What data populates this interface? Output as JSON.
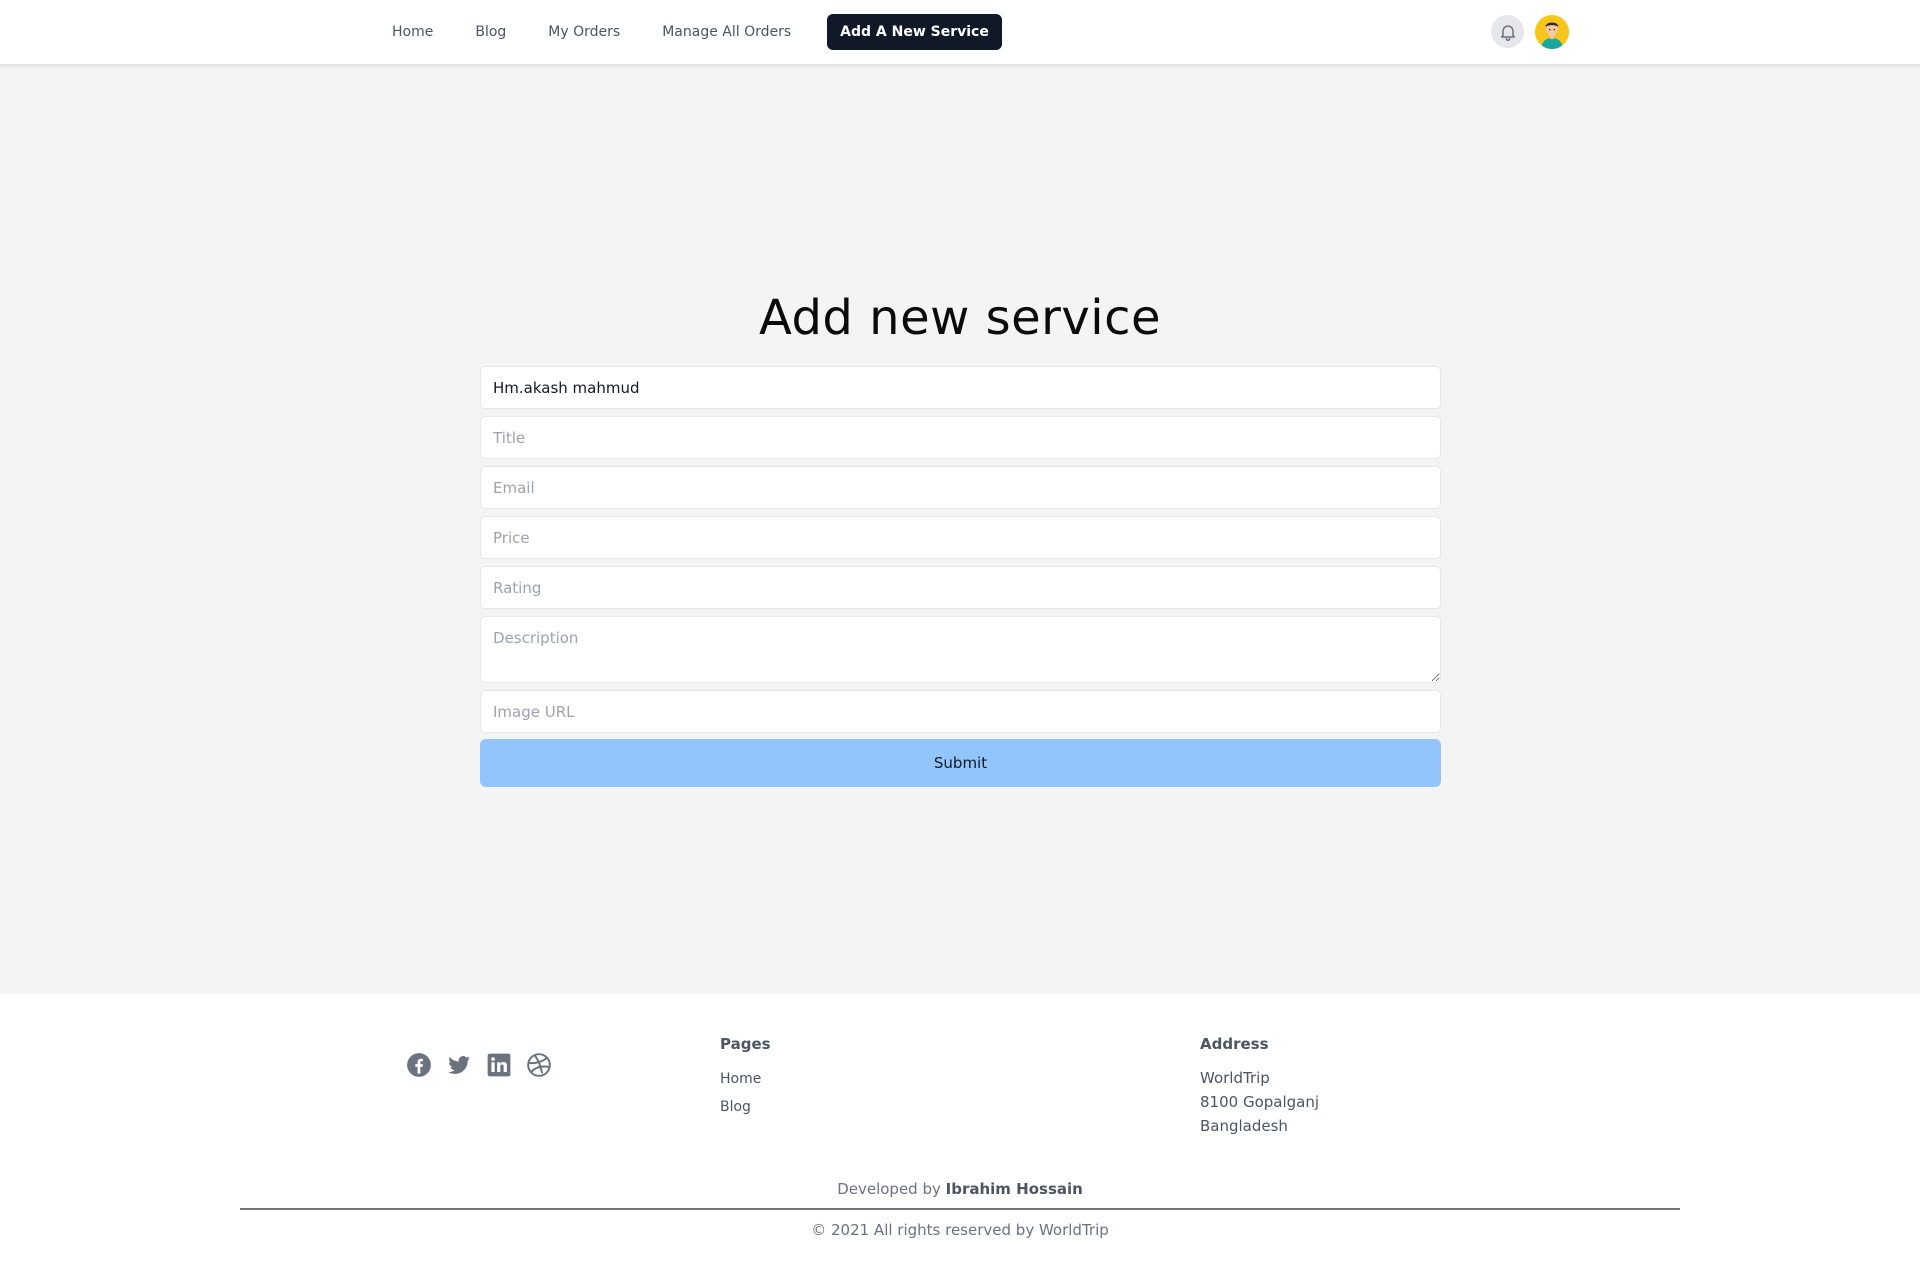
{
  "nav": {
    "links": [
      {
        "label": "Home"
      },
      {
        "label": "Blog"
      },
      {
        "label": "My Orders"
      },
      {
        "label": "Manage All Orders"
      },
      {
        "label": "Add A New Service",
        "active": true
      }
    ],
    "icons": {
      "notification": "bell-icon",
      "profile": "user-avatar"
    }
  },
  "form": {
    "title": "Add new service",
    "fields": {
      "name": {
        "value": "Hm.akash mahmud",
        "placeholder": ""
      },
      "title": {
        "placeholder": "Title"
      },
      "email": {
        "placeholder": "Email"
      },
      "price": {
        "placeholder": "Price"
      },
      "rating": {
        "placeholder": "Rating"
      },
      "description": {
        "placeholder": "Description"
      },
      "image_url": {
        "placeholder": "Image URL"
      }
    },
    "submit_label": "Submit"
  },
  "footer": {
    "social_icons": [
      "facebook-icon",
      "twitter-icon",
      "linkedin-icon",
      "dribbble-icon"
    ],
    "pages": {
      "title": "Pages",
      "links": [
        "Home",
        "Blog"
      ]
    },
    "address": {
      "title": "Address",
      "lines": [
        "WorldTrip",
        "8100 Gopalganj",
        "Bangladesh"
      ]
    },
    "developed_by_prefix": "Developed by",
    "developer_name": "Ibrahim Hossain",
    "copyright": "© 2021 All rights reserved by WorldTrip"
  },
  "colors": {
    "nav_active_bg": "#111827",
    "submit_bg": "#93c5fd",
    "page_bg": "#f4f4f4",
    "avatar_bg": "#f7c61a"
  }
}
